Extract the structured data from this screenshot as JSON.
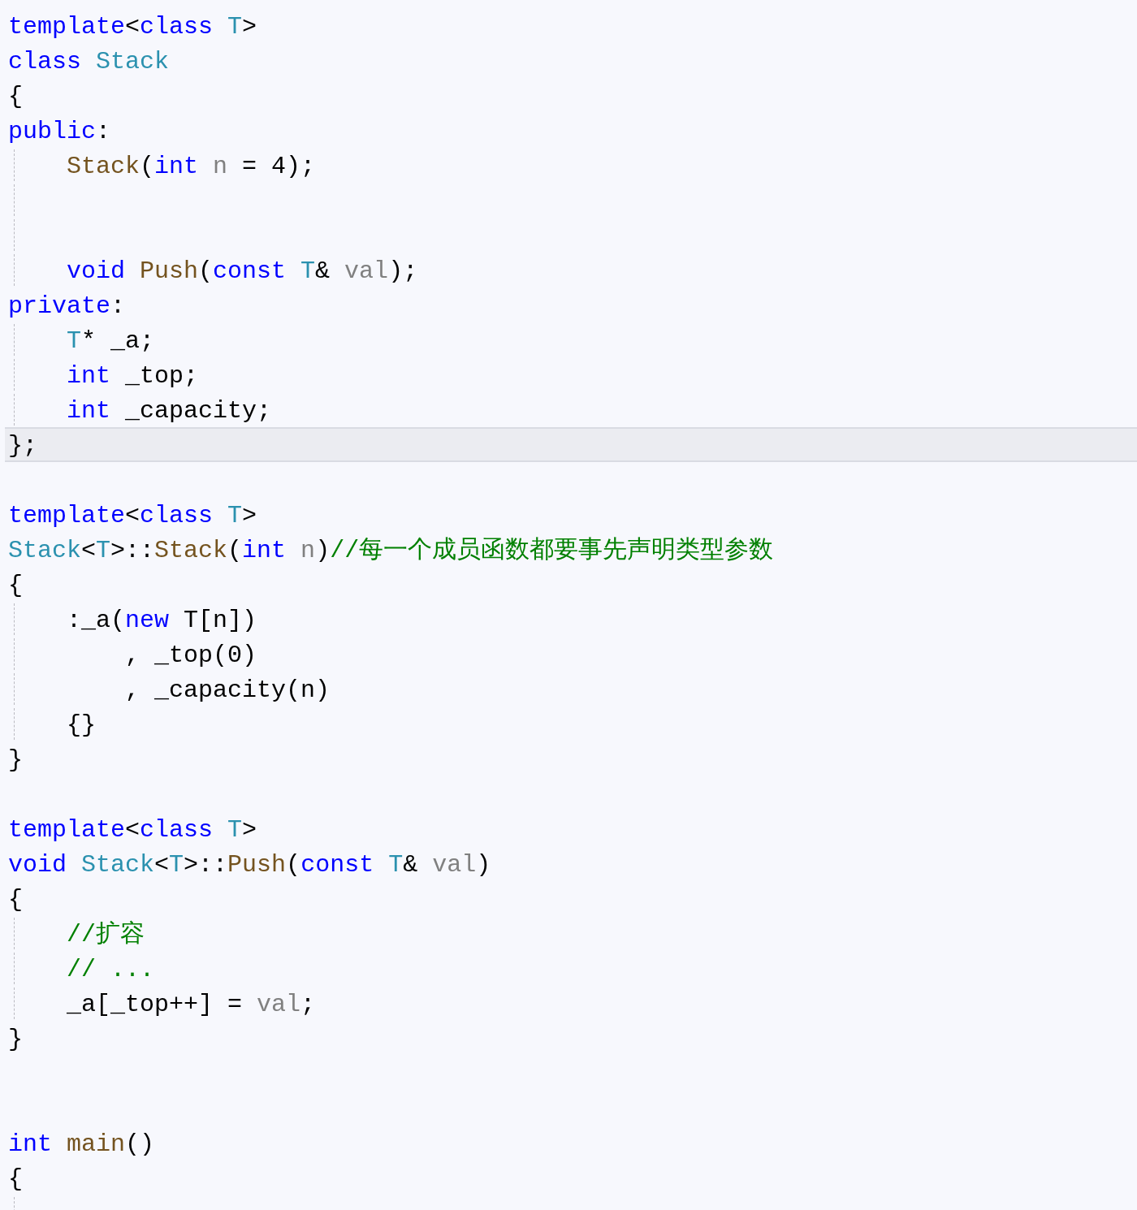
{
  "editor": {
    "lines": [
      {
        "guide": false,
        "current": false,
        "tokens": [
          {
            "kind": "keyword",
            "t": "template"
          },
          {
            "kind": "plain",
            "t": "<"
          },
          {
            "kind": "keyword",
            "t": "class"
          },
          {
            "kind": "type",
            "t": " T"
          },
          {
            "kind": "plain",
            "t": ">"
          }
        ]
      },
      {
        "guide": false,
        "current": false,
        "tokens": [
          {
            "kind": "keyword",
            "t": "class"
          },
          {
            "kind": "type",
            "t": " Stack"
          }
        ]
      },
      {
        "guide": false,
        "current": false,
        "tokens": [
          {
            "kind": "plain",
            "t": "{"
          }
        ]
      },
      {
        "guide": false,
        "current": false,
        "tokens": [
          {
            "kind": "keyword",
            "t": "public"
          },
          {
            "kind": "plain",
            "t": ":"
          }
        ]
      },
      {
        "guide": true,
        "current": false,
        "tokens": [
          {
            "kind": "function",
            "t": "    Stack"
          },
          {
            "kind": "plain",
            "t": "("
          },
          {
            "kind": "keyword",
            "t": "int"
          },
          {
            "kind": "parameter",
            "t": " n"
          },
          {
            "kind": "plain",
            "t": " = 4);"
          }
        ]
      },
      {
        "guide": true,
        "current": false
      },
      {
        "guide": true,
        "current": false
      },
      {
        "guide": true,
        "current": false,
        "tokens": [
          {
            "kind": "keyword",
            "t": "    void"
          },
          {
            "kind": "function",
            "t": " Push"
          },
          {
            "kind": "plain",
            "t": "("
          },
          {
            "kind": "keyword",
            "t": "const"
          },
          {
            "kind": "type",
            "t": " T"
          },
          {
            "kind": "plain",
            "t": "& "
          },
          {
            "kind": "parameter",
            "t": "val"
          },
          {
            "kind": "plain",
            "t": ");"
          }
        ]
      },
      {
        "guide": false,
        "current": false,
        "tokens": [
          {
            "kind": "keyword",
            "t": "private"
          },
          {
            "kind": "plain",
            "t": ":"
          }
        ]
      },
      {
        "guide": true,
        "current": false,
        "tokens": [
          {
            "kind": "type",
            "t": "    T"
          },
          {
            "kind": "plain",
            "t": "* _a;"
          }
        ]
      },
      {
        "guide": true,
        "current": false,
        "tokens": [
          {
            "kind": "keyword",
            "t": "    int"
          },
          {
            "kind": "plain",
            "t": " _top;"
          }
        ]
      },
      {
        "guide": true,
        "current": false,
        "tokens": [
          {
            "kind": "keyword",
            "t": "    int"
          },
          {
            "kind": "plain",
            "t": " _capacity;"
          }
        ]
      },
      {
        "guide": false,
        "current": true,
        "tokens": [
          {
            "kind": "plain",
            "t": "};"
          }
        ]
      },
      {
        "guide": false,
        "current": false
      },
      {
        "guide": false,
        "current": false,
        "tokens": [
          {
            "kind": "keyword",
            "t": "template"
          },
          {
            "kind": "plain",
            "t": "<"
          },
          {
            "kind": "keyword",
            "t": "class"
          },
          {
            "kind": "type",
            "t": " T"
          },
          {
            "kind": "plain",
            "t": ">"
          }
        ]
      },
      {
        "guide": false,
        "current": false,
        "tokens": [
          {
            "kind": "type",
            "t": "Stack"
          },
          {
            "kind": "plain",
            "t": "<"
          },
          {
            "kind": "type",
            "t": "T"
          },
          {
            "kind": "plain",
            "t": ">::"
          },
          {
            "kind": "function",
            "t": "Stack"
          },
          {
            "kind": "plain",
            "t": "("
          },
          {
            "kind": "keyword",
            "t": "int"
          },
          {
            "kind": "parameter",
            "t": " n"
          },
          {
            "kind": "plain",
            "t": ")"
          },
          {
            "kind": "comment",
            "t": "//每一个成员函数都要事先声明类型参数"
          }
        ]
      },
      {
        "guide": false,
        "current": false,
        "tokens": [
          {
            "kind": "plain",
            "t": "{"
          }
        ]
      },
      {
        "guide": true,
        "current": false,
        "tokens": [
          {
            "kind": "plain",
            "t": "    :_a("
          },
          {
            "kind": "keyword",
            "t": "new"
          },
          {
            "kind": "plain",
            "t": " T[n])"
          }
        ]
      },
      {
        "guide": true,
        "current": false,
        "tokens": [
          {
            "kind": "plain",
            "t": "        , _top(0)"
          }
        ]
      },
      {
        "guide": true,
        "current": false,
        "tokens": [
          {
            "kind": "plain",
            "t": "        , _capacity(n)"
          }
        ]
      },
      {
        "guide": true,
        "current": false,
        "tokens": [
          {
            "kind": "plain",
            "t": "    {}"
          }
        ]
      },
      {
        "guide": false,
        "current": false,
        "tokens": [
          {
            "kind": "plain",
            "t": "}"
          }
        ]
      },
      {
        "guide": false,
        "current": false
      },
      {
        "guide": false,
        "current": false,
        "tokens": [
          {
            "kind": "keyword",
            "t": "template"
          },
          {
            "kind": "plain",
            "t": "<"
          },
          {
            "kind": "keyword",
            "t": "class"
          },
          {
            "kind": "type",
            "t": " T"
          },
          {
            "kind": "plain",
            "t": ">"
          }
        ]
      },
      {
        "guide": false,
        "current": false,
        "tokens": [
          {
            "kind": "keyword",
            "t": "void"
          },
          {
            "kind": "type",
            "t": " Stack"
          },
          {
            "kind": "plain",
            "t": "<"
          },
          {
            "kind": "type",
            "t": "T"
          },
          {
            "kind": "plain",
            "t": ">::"
          },
          {
            "kind": "function",
            "t": "Push"
          },
          {
            "kind": "plain",
            "t": "("
          },
          {
            "kind": "keyword",
            "t": "const"
          },
          {
            "kind": "type",
            "t": " T"
          },
          {
            "kind": "plain",
            "t": "& "
          },
          {
            "kind": "parameter",
            "t": "val"
          },
          {
            "kind": "plain",
            "t": ")"
          }
        ]
      },
      {
        "guide": false,
        "current": false,
        "tokens": [
          {
            "kind": "plain",
            "t": "{"
          }
        ]
      },
      {
        "guide": true,
        "current": false,
        "tokens": [
          {
            "kind": "comment",
            "t": "    //扩容"
          }
        ]
      },
      {
        "guide": true,
        "current": false,
        "tokens": [
          {
            "kind": "comment",
            "t": "    // ..."
          }
        ]
      },
      {
        "guide": true,
        "current": false,
        "tokens": [
          {
            "kind": "plain",
            "t": "    _a[_top++] = "
          },
          {
            "kind": "parameter",
            "t": "val"
          },
          {
            "kind": "plain",
            "t": ";"
          }
        ]
      },
      {
        "guide": false,
        "current": false,
        "tokens": [
          {
            "kind": "plain",
            "t": "}"
          }
        ]
      },
      {
        "guide": false,
        "current": false
      },
      {
        "guide": false,
        "current": false
      },
      {
        "guide": false,
        "current": false,
        "tokens": [
          {
            "kind": "keyword",
            "t": "int"
          },
          {
            "kind": "function",
            "t": " main"
          },
          {
            "kind": "plain",
            "t": "()"
          }
        ]
      },
      {
        "guide": false,
        "current": false,
        "tokens": [
          {
            "kind": "plain",
            "t": "{"
          }
        ]
      },
      {
        "guide": true,
        "current": false
      }
    ]
  }
}
